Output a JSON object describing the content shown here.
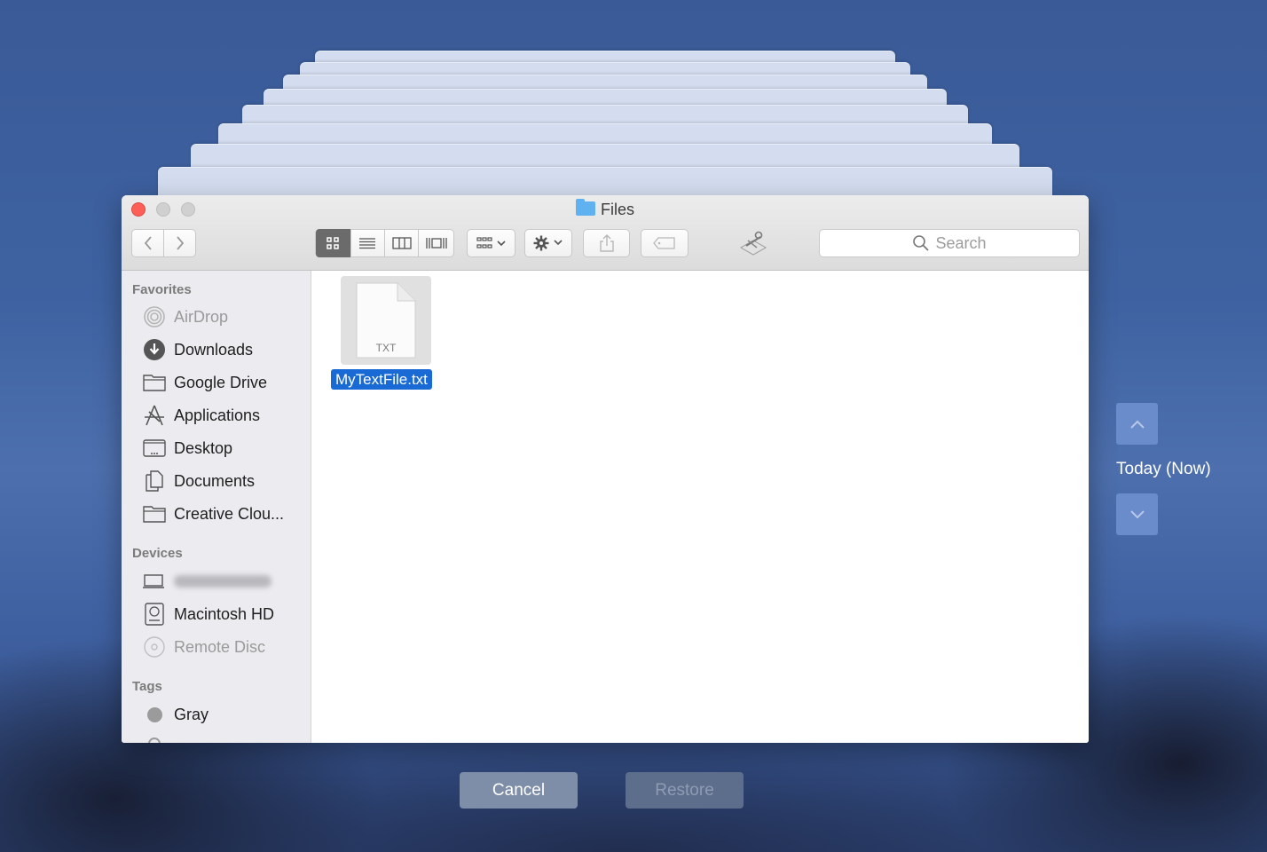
{
  "window": {
    "title": "Files"
  },
  "toolbar": {
    "back_icon": "chevron-left-icon",
    "forward_icon": "chevron-right-icon",
    "view_modes": [
      "icon-view",
      "list-view",
      "column-view",
      "cover-flow-view"
    ],
    "active_view": "icon-view",
    "search_placeholder": "Search"
  },
  "sidebar": {
    "favorites_label": "Favorites",
    "favorites": [
      {
        "label": "AirDrop",
        "icon": "airdrop-icon"
      },
      {
        "label": "Downloads",
        "icon": "downloads-icon"
      },
      {
        "label": "Google Drive",
        "icon": "folder-icon"
      },
      {
        "label": "Applications",
        "icon": "applications-icon"
      },
      {
        "label": "Desktop",
        "icon": "desktop-icon"
      },
      {
        "label": "Documents",
        "icon": "documents-icon"
      },
      {
        "label": "Creative Clou...",
        "icon": "folder-icon"
      }
    ],
    "devices_label": "Devices",
    "devices": [
      {
        "label": "",
        "icon": "laptop-icon"
      },
      {
        "label": "Macintosh HD",
        "icon": "hard-drive-icon"
      },
      {
        "label": "Remote Disc",
        "icon": "disc-icon"
      }
    ],
    "tags_label": "Tags",
    "tags": [
      {
        "label": "Gray",
        "color": "#9b9b9b"
      }
    ]
  },
  "content": {
    "files": [
      {
        "name": "MyTextFile.txt",
        "type_label": "TXT",
        "selected": true
      }
    ]
  },
  "timeline": {
    "current_label": "Today (Now)"
  },
  "actions": {
    "cancel_label": "Cancel",
    "restore_label": "Restore"
  },
  "colors": {
    "selection": "#1a6ad6",
    "close_light": "#fc5f57",
    "folder": "#5fb1ef"
  }
}
